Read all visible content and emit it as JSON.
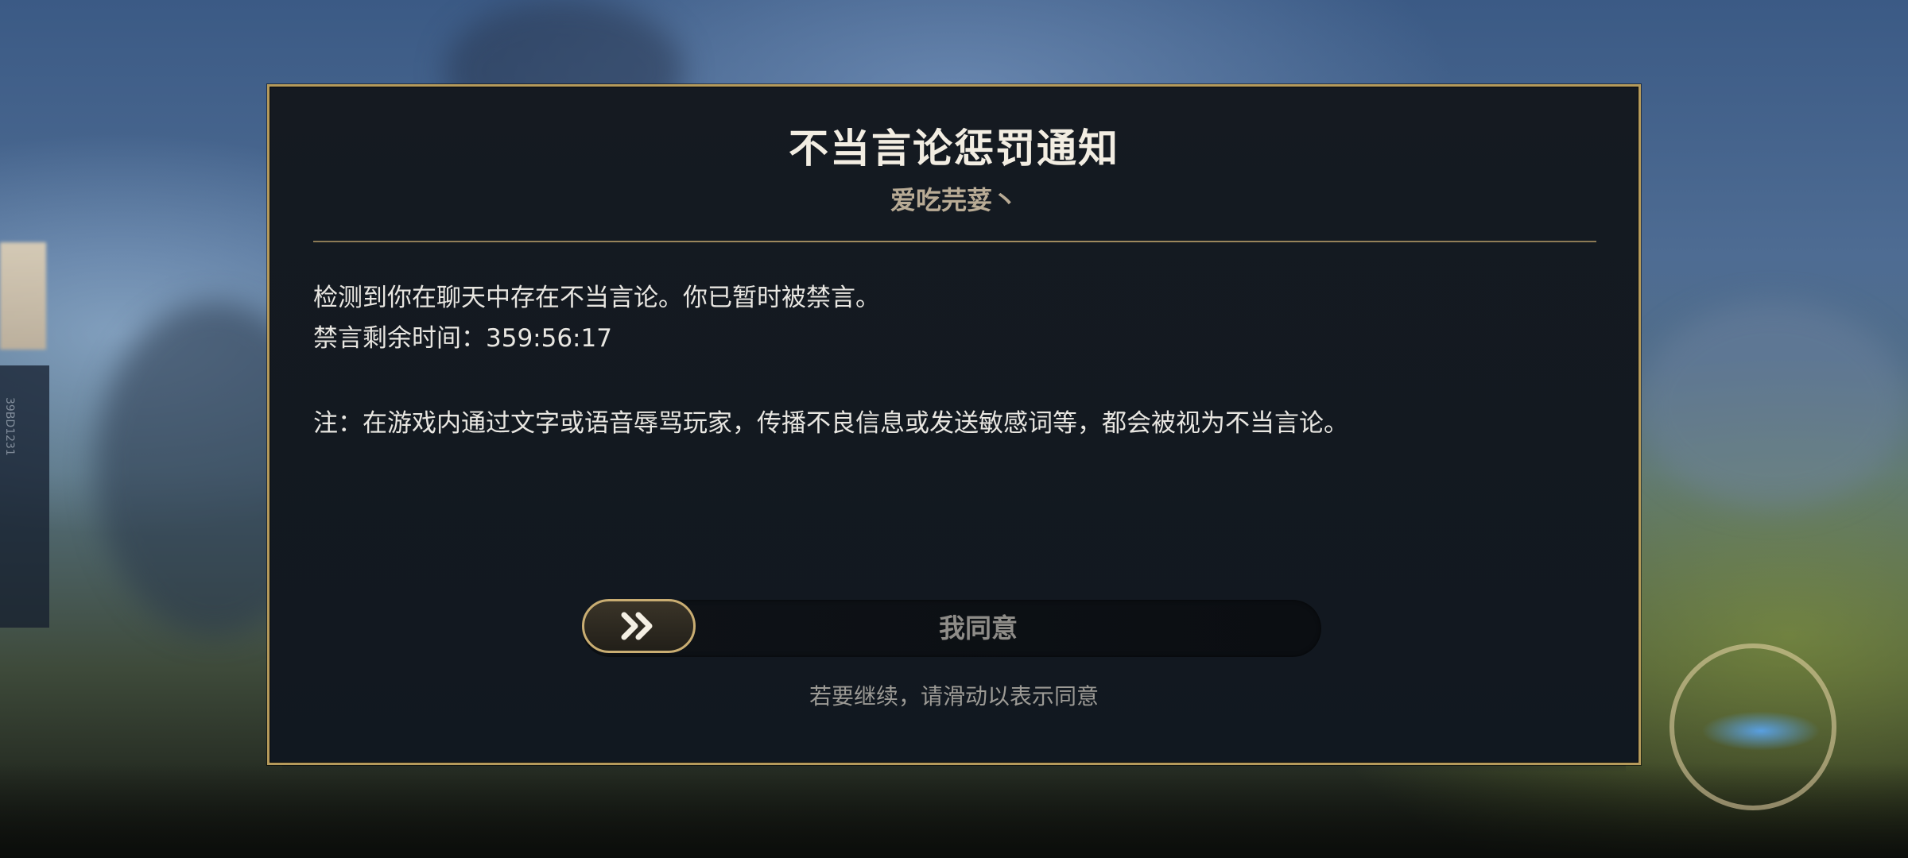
{
  "background": {
    "left_panel_text": "39BD1231"
  },
  "dialog": {
    "title": "不当言论惩罚通知",
    "subtitle": "爱吃芫荽丶",
    "message_line_1": "检测到你在聊天中存在不当言论。你已暂时被禁言。",
    "message_line_2": "禁言剩余时间：359:56:17",
    "note": "注：在游戏内通过文字或语音辱骂玩家，传播不良信息或发送敏感词等，都会被视为不当言论。",
    "slider": {
      "label": "我同意",
      "hint": "若要继续，请滑动以表示同意",
      "knob_icon": "double-chevron-right-icon",
      "progress": 0
    }
  },
  "colors": {
    "accent_gold": "#b59a5b",
    "dialog_bg": "#151a21",
    "title_text": "#f2ede2"
  }
}
